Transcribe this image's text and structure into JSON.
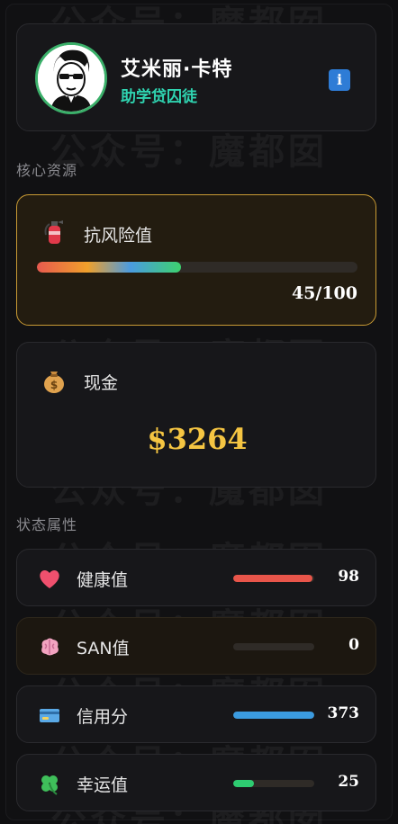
{
  "watermark": {
    "text": "公众号：魔都囡"
  },
  "profile": {
    "name": "艾米丽·卡特",
    "role": "助学贷囚徒",
    "info_icon": "info-icon",
    "info_label": "i"
  },
  "sections": {
    "core_resources": "核心资源",
    "status_attributes": "状态属性"
  },
  "resources": {
    "risk": {
      "icon": "fire-extinguisher-icon",
      "label": "抗风险值",
      "value_text": "45/100",
      "fraction": 0.45
    },
    "cash": {
      "icon": "money-bag-icon",
      "label": "现金",
      "value_text": "$3264"
    }
  },
  "stats": [
    {
      "icon": "heart-icon",
      "label": "健康值",
      "value": "98",
      "fraction": 0.98,
      "color": "#e8554a"
    },
    {
      "icon": "brain-icon",
      "label": "SAN值",
      "value": "0",
      "fraction": 0.0,
      "color": "#9b59b6"
    },
    {
      "icon": "credit-card-icon",
      "label": "信用分",
      "value": "373",
      "fraction": 1.0,
      "color": "#3b9be0"
    },
    {
      "icon": "four-leaf-clover-icon",
      "label": "幸运值",
      "value": "25",
      "fraction": 0.25,
      "color": "#2ecc71"
    }
  ],
  "colors": {
    "accent_gold": "#f5c542",
    "role_teal": "#2fd3b0",
    "risk_border": "#c89a34"
  }
}
